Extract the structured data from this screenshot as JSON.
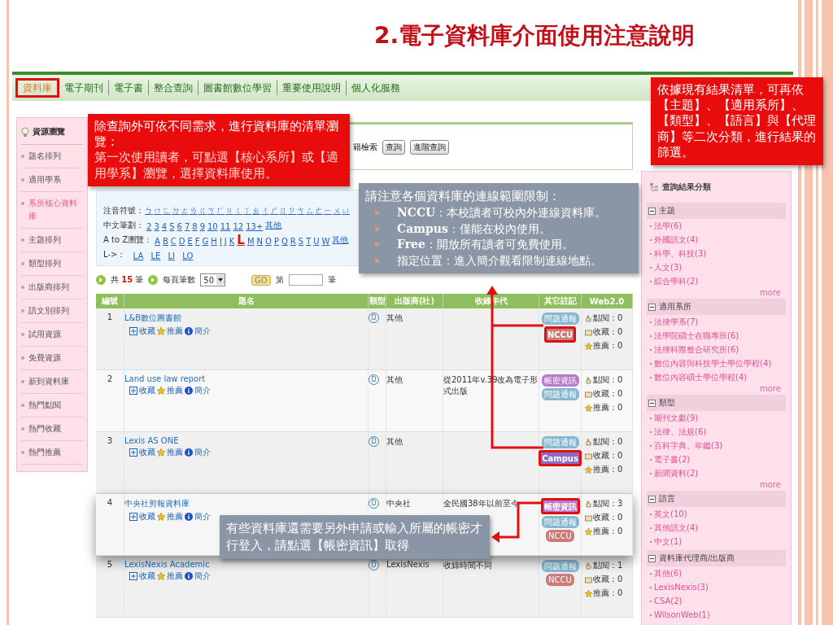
{
  "slide_title": "2.電子資料庫介面使用注意說明",
  "nav_tabs": [
    {
      "label": "資料庫",
      "selected": true,
      "highlighted": true
    },
    {
      "label": "電子期刊",
      "selected": false,
      "highlighted": false
    },
    {
      "label": "電子書",
      "selected": false,
      "highlighted": false
    },
    {
      "label": "整合查詢",
      "selected": false,
      "highlighted": false
    },
    {
      "label": "圖書館數位學習",
      "selected": false,
      "highlighted": false
    },
    {
      "label": "重要使用說明",
      "selected": false,
      "highlighted": false
    },
    {
      "label": "個人化服務",
      "selected": false,
      "highlighted": false
    }
  ],
  "sidebar": {
    "title": "資源瀏覽",
    "items": [
      {
        "label": "題名排列",
        "selected": false
      },
      {
        "label": "適用學系",
        "selected": false
      },
      {
        "label": "系所核心資料庫",
        "selected": true
      },
      {
        "label": "主題排列",
        "selected": false
      },
      {
        "label": "類型排列",
        "selected": false
      },
      {
        "label": "出版商排列",
        "selected": false
      },
      {
        "label": "語文別排列",
        "selected": false
      },
      {
        "label": "試用資源",
        "selected": false
      },
      {
        "label": "免費資源",
        "selected": false
      },
      {
        "label": "新到資料庫",
        "selected": false
      },
      {
        "label": "熱門點閱",
        "selected": false
      },
      {
        "label": "熱門收藏",
        "selected": false
      },
      {
        "label": "熱門推薦",
        "selected": false
      }
    ]
  },
  "search": {
    "text": "籍檢索",
    "buttons": [
      "查詢",
      "進階查詢"
    ]
  },
  "browse": {
    "zhuyin_label": "注音符號：",
    "zhuyin": [
      "ㄅ",
      "ㄇ",
      "ㄈ",
      "ㄉ",
      "ㄊ",
      "ㄌ",
      "ㄍ",
      "ㄎ",
      "ㄏ",
      "ㄐ",
      "ㄑ",
      "ㄒ",
      "ㄓ",
      "ㄔ",
      "ㄕ",
      "ㄖ",
      "ㄗ",
      "ㄘ",
      "ㄙ",
      "ㄜ",
      "ㄧ",
      "ㄨ",
      "ㄩ"
    ],
    "strokes_label": "中文筆劃：",
    "strokes": [
      "2",
      "3",
      "4",
      "5",
      "6",
      "7",
      "8",
      "9",
      "10",
      "11",
      "12",
      "13+",
      "其他"
    ],
    "az_label": "A to Z瀏覽：",
    "az": [
      {
        "label": "A",
        "selected": false
      },
      {
        "label": "B",
        "selected": false
      },
      {
        "label": "C",
        "selected": false
      },
      {
        "label": "D",
        "selected": false
      },
      {
        "label": "E",
        "selected": false
      },
      {
        "label": "F",
        "selected": false
      },
      {
        "label": "G",
        "selected": false
      },
      {
        "label": "H",
        "selected": false
      },
      {
        "label": "I",
        "selected": false
      },
      {
        "label": "J",
        "selected": false
      },
      {
        "label": "K",
        "selected": false
      },
      {
        "label": "L",
        "selected": true
      },
      {
        "label": "M",
        "selected": false
      },
      {
        "label": "N",
        "selected": false
      },
      {
        "label": "O",
        "selected": false
      },
      {
        "label": "P",
        "selected": false
      },
      {
        "label": "Q",
        "selected": false
      },
      {
        "label": "R",
        "selected": false
      },
      {
        "label": "S",
        "selected": false
      },
      {
        "label": "T",
        "selected": false
      },
      {
        "label": "U",
        "selected": false
      },
      {
        "label": "W",
        "selected": false
      },
      {
        "label": "其他",
        "selected": false
      }
    ],
    "sub_label": "L->：",
    "sub": [
      "LA",
      "LE",
      "LI",
      "LO"
    ]
  },
  "pager": {
    "total": "共 **15** 筆",
    "per_page_label": "每頁筆數",
    "per_page": "50",
    "go": "GO",
    "page_prefix": "第",
    "page_suffix": "筆"
  },
  "table": {
    "columns": [
      "編號",
      "題名",
      "類型",
      "出版商(社)",
      "收錄年代",
      "其它註記",
      "Web2.0"
    ],
    "rows": [
      {
        "number": "1",
        "title": "L&B數位圖書館",
        "actions": [
          "收藏",
          "推薦",
          "簡介"
        ],
        "type": "D",
        "publisher": "其他",
        "years": "",
        "raised": false,
        "notes": [
          {
            "label": "問題通報",
            "kind": "report",
            "highlighted": false
          },
          {
            "label": "NCCU",
            "kind": "nccu",
            "highlighted": true
          }
        ],
        "stats": [
          "點閱：0",
          "收藏：0",
          "推薦：0"
        ]
      },
      {
        "number": "2",
        "title": "Land use law report",
        "actions": [
          "收藏",
          "推薦",
          "簡介"
        ],
        "type": "D",
        "publisher": "其他",
        "years": "從2011年v.39改為電子形式出版",
        "raised": false,
        "notes": [
          {
            "label": "帳密資訊",
            "kind": "account",
            "highlighted": false
          },
          {
            "label": "問題通報",
            "kind": "report",
            "highlighted": false
          }
        ],
        "stats": [
          "點閱：0",
          "收藏：0",
          "推薦：0"
        ]
      },
      {
        "number": "3",
        "title": "Lexis AS ONE",
        "actions": [
          "收藏",
          "推薦",
          "簡介"
        ],
        "type": "D",
        "publisher": "其他",
        "years": "",
        "raised": false,
        "notes": [
          {
            "label": "問題通報",
            "kind": "report",
            "highlighted": false
          },
          {
            "label": "Campus",
            "kind": "campus",
            "highlighted": true
          }
        ],
        "stats": [
          "點閱：0",
          "收藏：0",
          "推薦：0"
        ]
      },
      {
        "number": "4",
        "title": "中央社剪報資料庫",
        "actions": [
          "收藏",
          "推薦",
          "簡介"
        ],
        "type": "D",
        "publisher": "中央社",
        "years": "全民國38年以前至今",
        "raised": true,
        "notes": [
          {
            "label": "帳密資訊",
            "kind": "account",
            "highlighted": true
          },
          {
            "label": "問題通報",
            "kind": "report",
            "highlighted": false
          },
          {
            "label": "NCCU",
            "kind": "nccu",
            "highlighted": false
          }
        ],
        "stats": [
          "點閱：3",
          "收藏：0",
          "推薦：0"
        ]
      },
      {
        "number": "5",
        "title": "LexisNexis Academic",
        "actions": [
          "收藏",
          "推薦",
          "簡介"
        ],
        "type": "D",
        "publisher": "LexisNexis",
        "years": "收錄時間不同",
        "raised": false,
        "notes": [
          {
            "label": "問題通報",
            "kind": "report",
            "highlighted": false
          },
          {
            "label": "NCCU",
            "kind": "nccu",
            "highlighted": false
          }
        ],
        "stats": [
          "點閱：1",
          "收藏：0",
          "推薦：0"
        ]
      }
    ]
  },
  "facets": {
    "title": "查詢結果分類",
    "groups": [
      {
        "title": "主題",
        "items": [
          "法學(6)",
          "外國語文(4)",
          "科學、科技(3)",
          "人文(3)",
          "綜合學科(2)"
        ],
        "more": "more"
      },
      {
        "title": "適用系所",
        "items": [
          "法律學系(7)",
          "法學院碩士在職專班(6)",
          "法律科際整合研究所(6)",
          "數位內容與科技學士學位學程(4)",
          "數位內容碩士學位學程(4)"
        ],
        "more": "more"
      },
      {
        "title": "類型",
        "items": [
          "期刊文獻(9)",
          "法律、法規(6)",
          "百科字典、年鑑(3)",
          "電子書(2)",
          "新聞資料(2)"
        ],
        "more": "more"
      },
      {
        "title": "語言",
        "items": [
          "英文(10)",
          "其他語文(4)",
          "中文(1)"
        ]
      },
      {
        "title": "資料庫代理商/出版商",
        "items": [
          "其他(6)",
          "LexisNexis(3)",
          "CSA(2)",
          "WilsonWeb(1)"
        ]
      }
    ]
  },
  "callouts": [
    {
      "kind": "red",
      "paragraphs": [
        {
          "kind": "heading",
          "text": "除查詢外可依不同需求，進行資料庫的清單瀏覽："
        },
        {
          "kind": "body",
          "text": "第一次使用讀者，可點選【核心系所】或【適用學系】瀏覽，選擇資料庫使用。"
        }
      ]
    },
    {
      "kind": "red",
      "paragraphs": [
        {
          "kind": "heading",
          "text": "依據現有結果清單，可再依【主題】、【適用系所】、【類型】、【語言】與【代理商】等二次分類，進行結果的篩選。"
        }
      ]
    },
    {
      "kind": "grey",
      "paragraphs": [
        {
          "kind": "heading",
          "text": "請注意各個資料庫的連線範圍限制："
        },
        {
          "kind": "bullet",
          "text": "**NCCU**：本校讀者可校內外連線資料庫。"
        },
        {
          "kind": "bullet",
          "text": "**Campus**：僅能在校內使用。"
        },
        {
          "kind": "bullet",
          "text": "**Free**：開放所有讀者可免費使用。"
        },
        {
          "kind": "bullet",
          "text": "指定位置：進入簡介觀看限制連線地點。"
        }
      ]
    },
    {
      "kind": "grey",
      "paragraphs": [
        {
          "kind": "heading",
          "text": "有些資料庫還需要另外申請或輸入所屬的帳密才行登入，請點選【帳密資訊】取得"
        }
      ]
    }
  ]
}
